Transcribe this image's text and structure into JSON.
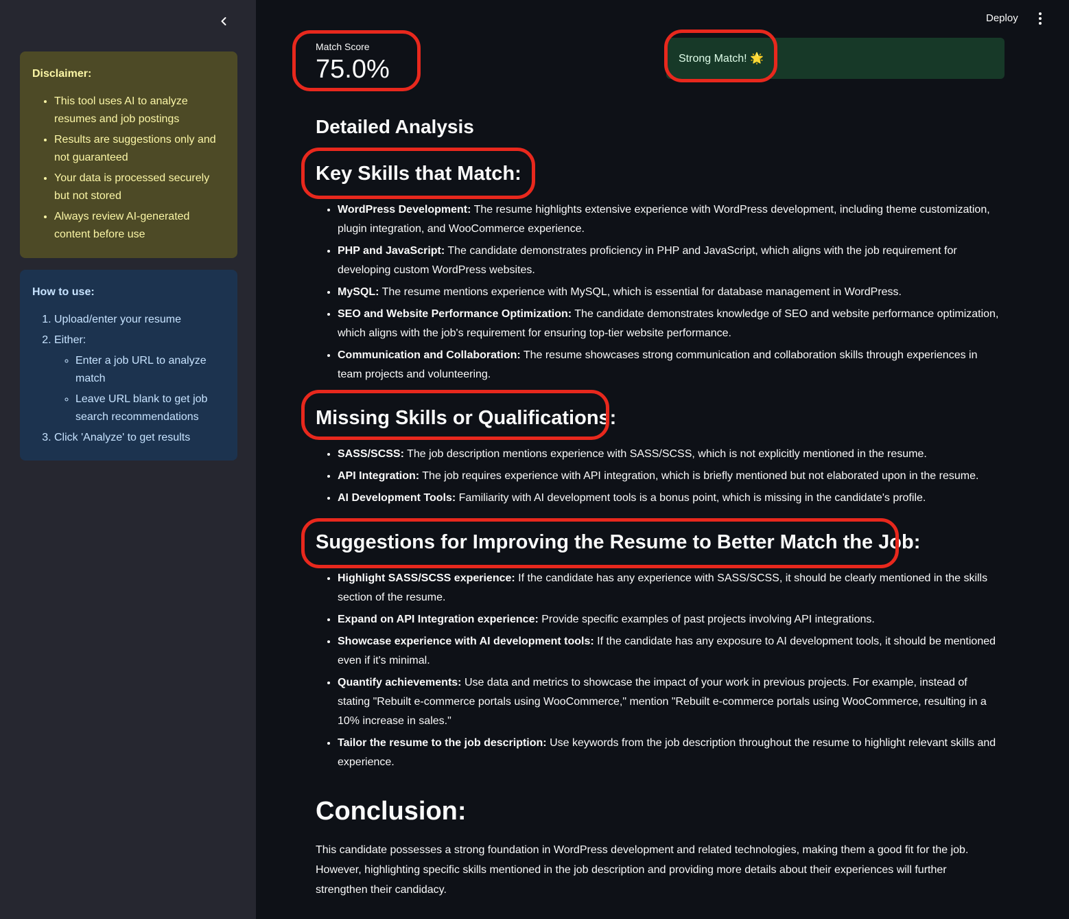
{
  "sidebar": {
    "collapse_icon": "chevron-left-icon",
    "disclaimer": {
      "title": "Disclaimer:",
      "items": [
        "This tool uses AI to analyze resumes and job postings",
        "Results are suggestions only and not guaranteed",
        "Your data is processed securely but not stored",
        "Always review AI-generated content before use"
      ]
    },
    "how_to": {
      "title": "How to use:",
      "steps": {
        "s1": "Upload/enter your resume",
        "s2": "Either:",
        "s2_sub": [
          "Enter a job URL to analyze match",
          "Leave URL blank to get job search recommendations"
        ],
        "s3": "Click 'Analyze' to get results"
      }
    }
  },
  "header": {
    "deploy_label": "Deploy",
    "menu_icon": "kebab-menu-icon"
  },
  "metric": {
    "label": "Match Score",
    "value": "75.0%"
  },
  "status": {
    "text": "Strong Match! 🌟",
    "color": "#173928"
  },
  "analysis": {
    "title": "Detailed Analysis",
    "key_skills": {
      "heading": "Key Skills that Match:",
      "items": [
        {
          "term": "WordPress Development:",
          "text": " The resume highlights extensive experience with WordPress development, including theme customization, plugin integration, and WooCommerce experience."
        },
        {
          "term": "PHP and JavaScript:",
          "text": " The candidate demonstrates proficiency in PHP and JavaScript, which aligns with the job requirement for developing custom WordPress websites."
        },
        {
          "term": "MySQL:",
          "text": " The resume mentions experience with MySQL, which is essential for database management in WordPress."
        },
        {
          "term": "SEO and Website Performance Optimization:",
          "text": " The candidate demonstrates knowledge of SEO and website performance optimization, which aligns with the job's requirement for ensuring top-tier website performance."
        },
        {
          "term": "Communication and Collaboration:",
          "text": " The resume showcases strong communication and collaboration skills through experiences in team projects and volunteering."
        }
      ]
    },
    "missing": {
      "heading": "Missing Skills or Qualifications:",
      "items": [
        {
          "term": "SASS/SCSS:",
          "text": " The job description mentions experience with SASS/SCSS, which is not explicitly mentioned in the resume."
        },
        {
          "term": "API Integration:",
          "text": " The job requires experience with API integration, which is briefly mentioned but not elaborated upon in the resume."
        },
        {
          "term": "AI Development Tools:",
          "text": " Familiarity with AI development tools is a bonus point, which is missing in the candidate's profile."
        }
      ]
    },
    "suggestions": {
      "heading": "Suggestions for Improving the Resume to Better Match the Job:",
      "items": [
        {
          "term": "Highlight SASS/SCSS experience:",
          "text": " If the candidate has any experience with SASS/SCSS, it should be clearly mentioned in the skills section of the resume."
        },
        {
          "term": "Expand on API Integration experience:",
          "text": " Provide specific examples of past projects involving API integrations."
        },
        {
          "term": "Showcase experience with AI development tools:",
          "text": " If the candidate has any exposure to AI development tools, it should be mentioned even if it's minimal."
        },
        {
          "term": "Quantify achievements:",
          "text": " Use data and metrics to showcase the impact of your work in previous projects. For example, instead of stating \"Rebuilt e-commerce portals using WooCommerce,\" mention \"Rebuilt e-commerce portals using WooCommerce, resulting in a 10% increase in sales.\""
        },
        {
          "term": "Tailor the resume to the job description:",
          "text": " Use keywords from the job description throughout the resume to highlight relevant skills and experience."
        }
      ]
    },
    "conclusion": {
      "heading": "Conclusion:",
      "text": "This candidate possesses a strong foundation in WordPress development and related technologies, making them a good fit for the job. However, highlighting specific skills mentioned in the job description and providing more details about their experiences will further strengthen their candidacy."
    }
  },
  "highlight_color": "#e8281d"
}
